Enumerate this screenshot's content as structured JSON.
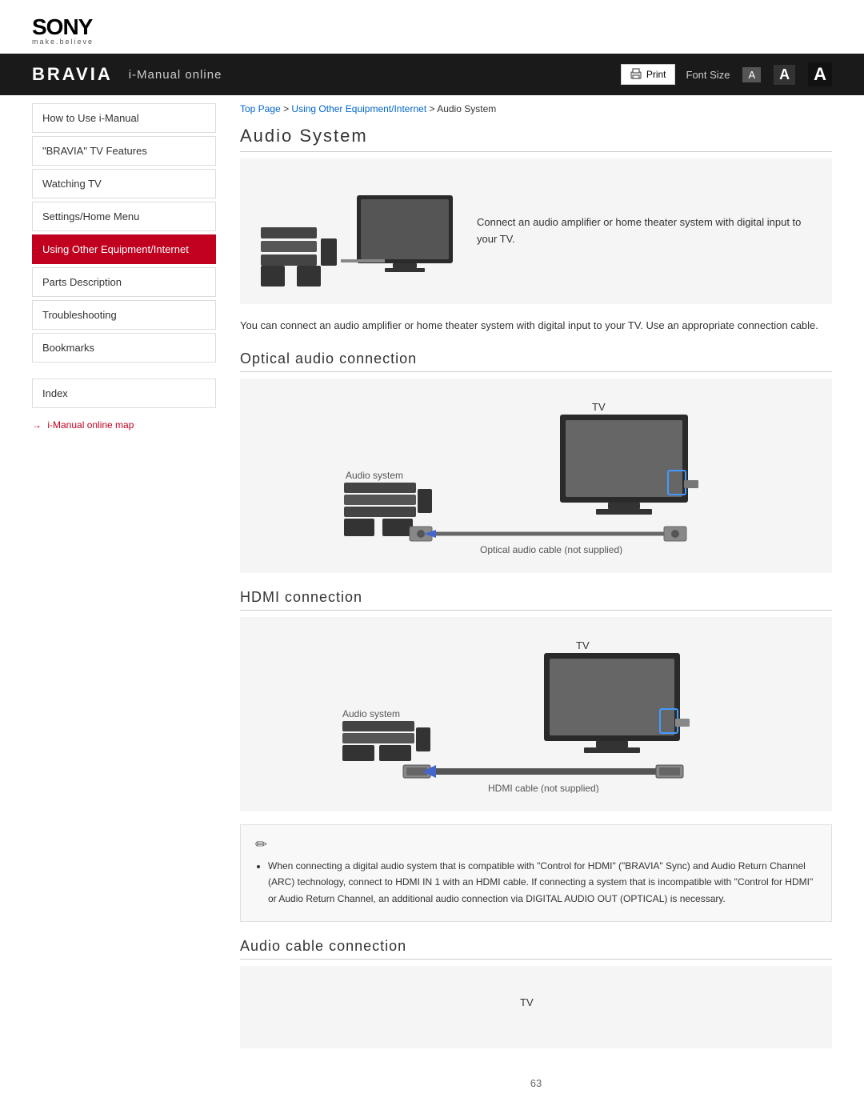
{
  "header": {
    "sony_logo": "SONY",
    "sony_tagline": "make.believe",
    "bravia_logo": "BRAVIA",
    "navbar_title": "i-Manual online",
    "print_label": "Print",
    "font_size_label": "Font Size",
    "font_small": "A",
    "font_medium": "A",
    "font_large": "A"
  },
  "breadcrumb": {
    "top_page": "Top Page",
    "separator1": " > ",
    "using_other": "Using Other Equipment/Internet",
    "separator2": " > ",
    "current": "Audio System"
  },
  "sidebar": {
    "items": [
      {
        "label": "How to Use i-Manual",
        "active": false
      },
      {
        "label": "\"BRAVIA\" TV Features",
        "active": false
      },
      {
        "label": "Watching TV",
        "active": false
      },
      {
        "label": "Settings/Home Menu",
        "active": false
      },
      {
        "label": "Using Other Equipment/Internet",
        "active": true
      },
      {
        "label": "Parts Description",
        "active": false
      },
      {
        "label": "Troubleshooting",
        "active": false
      },
      {
        "label": "Bookmarks",
        "active": false
      }
    ],
    "index_label": "Index",
    "map_link": "i-Manual online map"
  },
  "content": {
    "page_title": "Audio System",
    "intro_text": "Connect an audio amplifier or home theater system with digital input to your TV.",
    "paragraph": "You can connect an audio amplifier or home theater system with digital input to your TV. Use an appropriate connection cable.",
    "optical_section": {
      "title": "Optical audio connection",
      "tv_label": "TV",
      "audio_label": "Audio system",
      "cable_label": "Optical audio cable (not supplied)"
    },
    "hdmi_section": {
      "title": "HDMI connection",
      "tv_label": "TV",
      "audio_label": "Audio system",
      "cable_label": "HDMI cable (not supplied)"
    },
    "note_text": "When connecting a digital audio system that is compatible with \"Control for HDMI\" (\"BRAVIA\" Sync) and Audio Return Channel (ARC) technology, connect to HDMI IN 1 with an HDMI cable. If connecting a system that is incompatible with \"Control for HDMI\" or Audio Return Channel, an additional audio connection via DIGITAL AUDIO OUT (OPTICAL) is necessary.",
    "audio_cable_section": {
      "title": "Audio cable connection",
      "tv_label": "TV"
    },
    "page_number": "63"
  }
}
